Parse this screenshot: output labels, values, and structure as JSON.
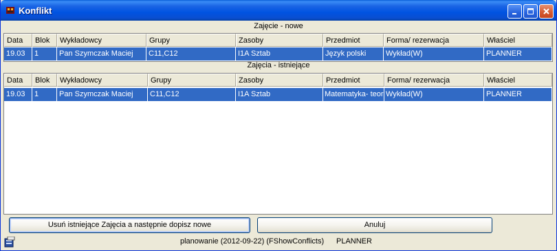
{
  "window": {
    "title": "Konflikt",
    "controls": [
      "minimize-icon",
      "maximize-icon",
      "close-icon"
    ]
  },
  "new_section": {
    "label": "Zajęcie - nowe",
    "headers": [
      "Data",
      "Blok",
      "Wykładowcy",
      "Grupy",
      "Zasoby",
      "Przedmiot",
      "Forma/ rezerwacja",
      "Właściel"
    ],
    "rows": [
      [
        "19.03",
        "1",
        "Pan Szymczak Maciej",
        "C11,C12",
        "I1A Sztab",
        "Język polski",
        "Wykład(W)",
        "PLANNER"
      ]
    ]
  },
  "existing_section": {
    "label": "Zajęcia - istniejące",
    "headers": [
      "Data",
      "Blok",
      "Wykładowcy",
      "Grupy",
      "Zasoby",
      "Przedmiot",
      "Forma/ rezerwacja",
      "Właściel"
    ],
    "rows": [
      [
        "19.03",
        "1",
        "Pan Szymczak Maciej",
        "C11,C12",
        "I1A Sztab",
        "Matematyka- teori",
        "Wykład(W)",
        "PLANNER"
      ]
    ]
  },
  "buttons": {
    "replace_label": "Usuń istniejące Zajęcia a następnie dopisz nowe",
    "cancel_label": "Anuluj"
  },
  "statusbar": {
    "text": "planowanie (2012-09-22) (FShowConflicts)",
    "user": "PLANNER"
  },
  "colors": {
    "selection": "#316ac5",
    "titlebar": "#0053e1",
    "face": "#ece9d8"
  }
}
